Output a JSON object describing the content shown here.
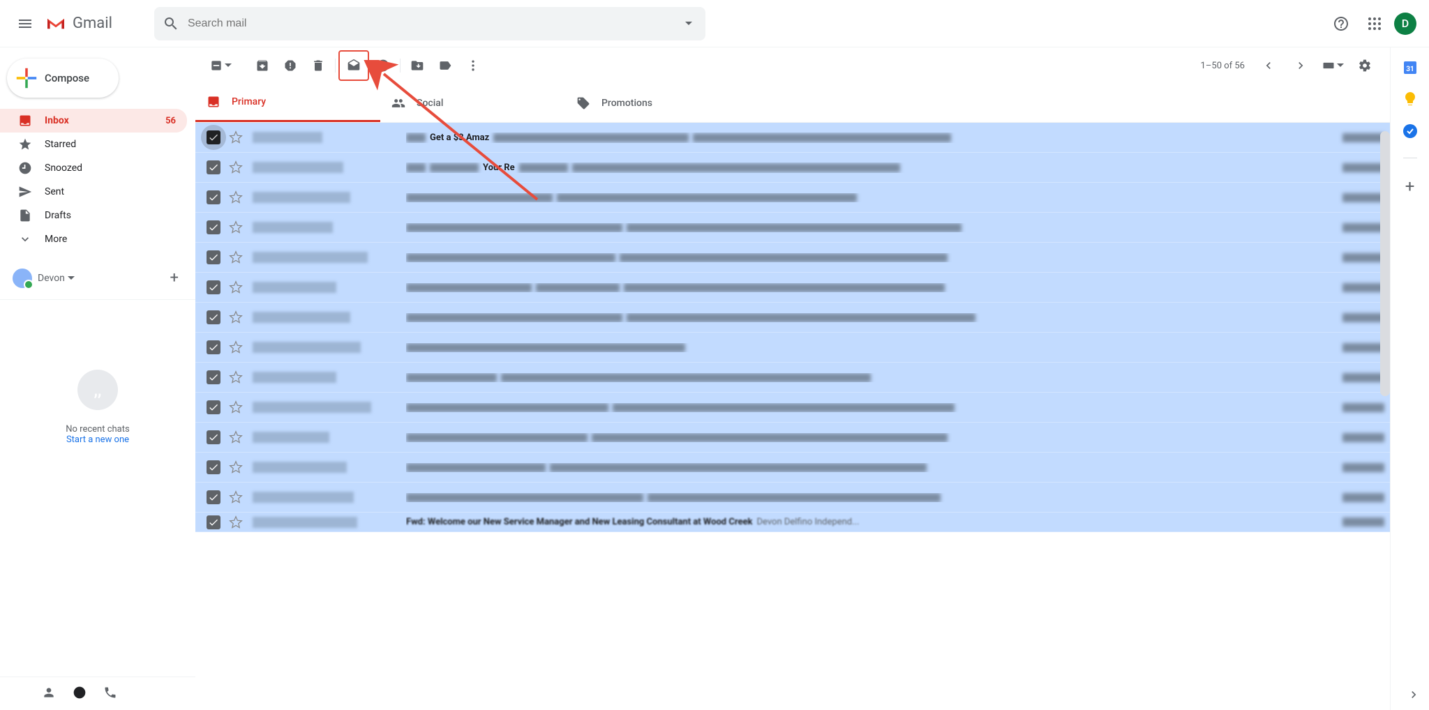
{
  "header": {
    "logo_text": "Gmail",
    "search_placeholder": "Search mail",
    "avatar_letter": "D"
  },
  "sidebar": {
    "compose": "Compose",
    "items": [
      {
        "label": "Inbox",
        "count": "56",
        "active": true,
        "icon": "inbox"
      },
      {
        "label": "Starred",
        "icon": "star"
      },
      {
        "label": "Snoozed",
        "icon": "clock"
      },
      {
        "label": "Sent",
        "icon": "send"
      },
      {
        "label": "Drafts",
        "icon": "draft"
      },
      {
        "label": "More",
        "icon": "expand"
      }
    ],
    "hangouts_user": "Devon",
    "no_chat_text": "No recent chats",
    "start_new": "Start a new one"
  },
  "toolbar": {
    "page_label": "1–50 of 56"
  },
  "tabs": [
    {
      "label": "Primary",
      "active": true
    },
    {
      "label": "Social"
    },
    {
      "label": "Promotions"
    }
  ],
  "emails": {
    "row0_subject_a": "Get a $3 Amaz",
    "row1_subject_a": "Your Re",
    "row_last": "Fwd: Welcome our New Service Manager and New Leasing Consultant at Wood Creek",
    "row_last_preview": "Devon Delfino Independ..."
  }
}
